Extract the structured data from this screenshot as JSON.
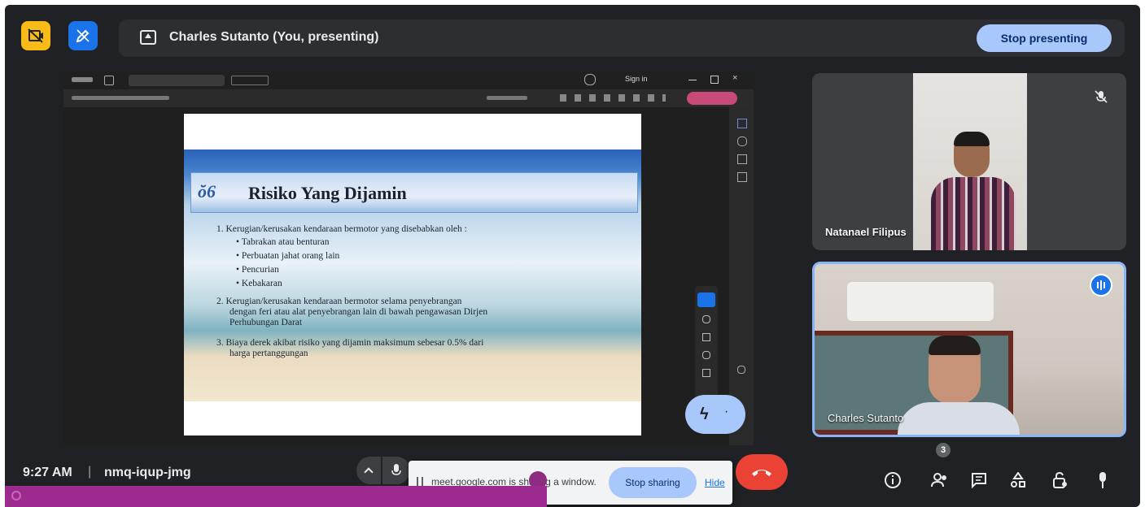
{
  "header": {
    "presenting_text": "Charles Sutanto (You, presenting)",
    "stop_presenting_label": "Stop presenting"
  },
  "shared_screen": {
    "browser_controls": {
      "sign_in_label": "Sign in"
    },
    "slide": {
      "title": "Risiko Yang Dijamin",
      "item1": "1.  Kerugian/kerusakan kendaraan bermotor yang disebabkan oleh :",
      "bullets": [
        "• Tabrakan atau benturan",
        "• Perbuatan jahat orang lain",
        "• Pencurian",
        "• Kebakaran"
      ],
      "item2_line1": "2.  Kerugian/kerusakan kendaraan bermotor selama penyebrangan",
      "item2_line2": "dengan feri atau alat penyebrangan lain di bawah pengawasan Dirjen",
      "item2_line3": "Perhubungan Darat",
      "item3_line1": "3.  Biaya derek akibat risiko yang dijamin maksimum sebesar 0.5% dari",
      "item3_line2": "harga pertanggungan"
    }
  },
  "participants": [
    {
      "name": "Natanael Filipus"
    },
    {
      "name": "Charles Sutanto"
    }
  ],
  "footer": {
    "time": "9:27 AM",
    "separator": "|",
    "meeting_code": "nmq-iqup-jmg",
    "share_notice": "meet.google.com is sharing a window.",
    "stop_sharing_label": "Stop sharing",
    "hide_label": "Hide",
    "people_count": "3"
  },
  "colors": {
    "meet_bg": "#202124",
    "accent_blue": "#a8c7fa",
    "leave_red": "#ea4335",
    "camera_off_yellow": "#fbbc04",
    "overlay_purple": "#9c2a8f"
  },
  "icons": {
    "camera_off": "camera-off-icon",
    "draw": "pen-icon",
    "present": "present-icon",
    "mic_off": "mic-off-icon",
    "speaking": "audio-level-icon"
  }
}
